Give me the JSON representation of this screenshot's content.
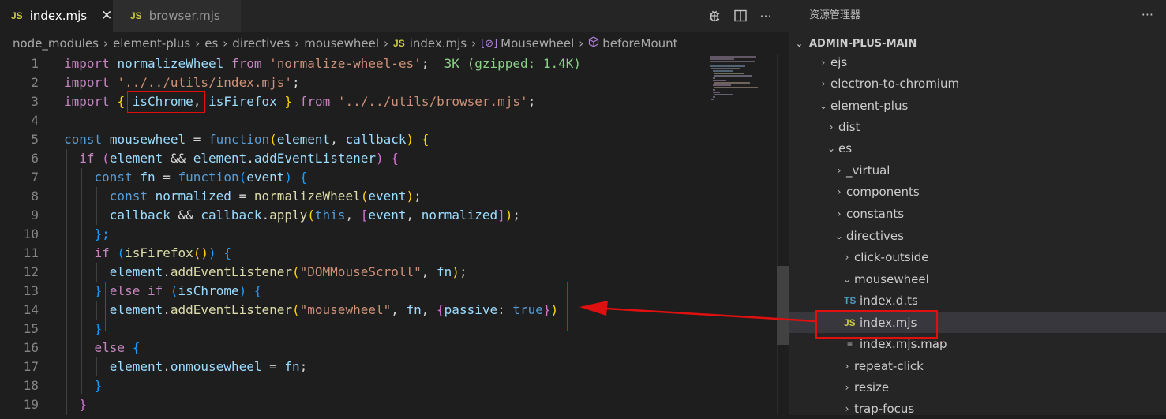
{
  "tabs": [
    {
      "badge": "JS",
      "label": "index.mjs",
      "close": "✕"
    },
    {
      "badge": "JS",
      "label": "browser.mjs"
    }
  ],
  "tab_actions": {
    "more": "···"
  },
  "breadcrumb": {
    "items": [
      "node_modules",
      "element-plus",
      "es",
      "directives",
      "mousewheel"
    ],
    "file_badge": "JS",
    "file": "index.mjs",
    "symbol_icon": "[⊘]",
    "symbol1": "Mousewheel",
    "symbol2": "beforeMount",
    "separator": "›"
  },
  "code": {
    "line_numbers": [
      "1",
      "2",
      "3",
      "4",
      "5",
      "6",
      "7",
      "8",
      "9",
      "10",
      "11",
      "12",
      "13",
      "14",
      "15",
      "16",
      "17",
      "18",
      "19"
    ],
    "l1": {
      "import": "import",
      "name": "normalizeWheel",
      "from": "from",
      "path": "'normalize-wheel-es'",
      "semi": ";",
      "hint": "3K (gzipped: 1.4K)"
    },
    "l2": {
      "import": "import",
      "path": "'../../utils/index.mjs'",
      "semi": ";"
    },
    "l3": {
      "import": "import",
      "open": "{",
      "n1": "isChrome",
      "comma": ",",
      "n2": "isFirefox",
      "close": "}",
      "from": "from",
      "path": "'../../utils/browser.mjs'",
      "semi": ";"
    },
    "l5": {
      "const": "const",
      "name": "mousewheel",
      "eq": " = ",
      "function": "function",
      "p1": "(",
      "a1": "element",
      "c": ", ",
      "a2": "callback",
      "p2": ")",
      "b": "{"
    },
    "l6": {
      "if": "if",
      "p1": "(",
      "a": "element",
      "and": " && ",
      "b": "element",
      "dot": ".",
      "m": "addEventListener",
      "p2": ")",
      "br": "{"
    },
    "l7": {
      "const": "const",
      "name": "fn",
      "eq": " = ",
      "function": "function",
      "p1": "(",
      "a": "event",
      "p2": ")",
      "br": "{"
    },
    "l8": {
      "const": "const",
      "name": "normalized",
      "eq": " = ",
      "fn": "normalizeWheel",
      "p1": "(",
      "a": "event",
      "p2": ")",
      "semi": ";"
    },
    "l9": {
      "a": "callback",
      "and": " && ",
      "b": "callback",
      "dot": ".",
      "m": "apply",
      "p1": "(",
      "this": "this",
      "c": ", ",
      "o": "[",
      "x": "event",
      "c2": ", ",
      "y": "normalized",
      "cl": "]",
      "p2": ")",
      "semi": ";"
    },
    "l10": {
      "text": "};"
    },
    "l11": {
      "if": "if",
      "p1": "(",
      "fn": "isFirefox",
      "p2": "()",
      "p3": ")",
      "br": "{"
    },
    "l12": {
      "a": "element",
      "dot": ".",
      "m": "addEventListener",
      "p1": "(",
      "s": "\"DOMMouseScroll\"",
      "c": ", ",
      "b": "fn",
      "p2": ")",
      "semi": ";"
    },
    "l13": {
      "close": "}",
      "else": "else",
      "if": "if",
      "p1": "(",
      "a": "isChrome",
      "p2": ")",
      "br": "{"
    },
    "l14": {
      "a": "element",
      "dot": ".",
      "m": "addEventListener",
      "p1": "(",
      "s": "\"mousewheel\"",
      "c": ", ",
      "b": "fn",
      "c2": ", ",
      "o": "{",
      "k": "passive",
      "colon": ": ",
      "v": "true",
      "oc": "}",
      "p2": ")"
    },
    "l15": {
      "text": "}"
    },
    "l16": {
      "else": "else",
      "br": "{"
    },
    "l17": {
      "a": "element",
      "dot": ".",
      "m": "onmousewheel",
      "eq": " = ",
      "b": "fn",
      "semi": ";"
    },
    "l18": {
      "text": "}"
    },
    "l19": {
      "text": "}"
    }
  },
  "explorer": {
    "title": "资源管理器",
    "more": "···",
    "root": "ADMIN-PLUS-MAIN",
    "items": [
      {
        "label": "ejs",
        "chev": "›"
      },
      {
        "label": "electron-to-chromium",
        "chev": "›"
      },
      {
        "label": "element-plus",
        "chev": "⌄"
      },
      {
        "label": "dist",
        "chev": "›"
      },
      {
        "label": "es",
        "chev": "⌄"
      },
      {
        "label": "_virtual",
        "chev": "›"
      },
      {
        "label": "components",
        "chev": "›"
      },
      {
        "label": "constants",
        "chev": "›"
      },
      {
        "label": "directives",
        "chev": "⌄"
      },
      {
        "label": "click-outside",
        "chev": "›"
      },
      {
        "label": "mousewheel",
        "chev": "⌄"
      },
      {
        "label": "index.d.ts",
        "icon": "TS"
      },
      {
        "label": "index.mjs",
        "icon": "JS"
      },
      {
        "label": "index.mjs.map",
        "icon": "≡"
      },
      {
        "label": "repeat-click",
        "chev": "›"
      },
      {
        "label": "resize",
        "chev": "›"
      },
      {
        "label": "trap-focus",
        "chev": "›"
      }
    ]
  },
  "colors": {
    "annotation": "#e01010",
    "selection": "#37373d",
    "js_badge": "#cbcb41",
    "ts_badge": "#519aba"
  }
}
